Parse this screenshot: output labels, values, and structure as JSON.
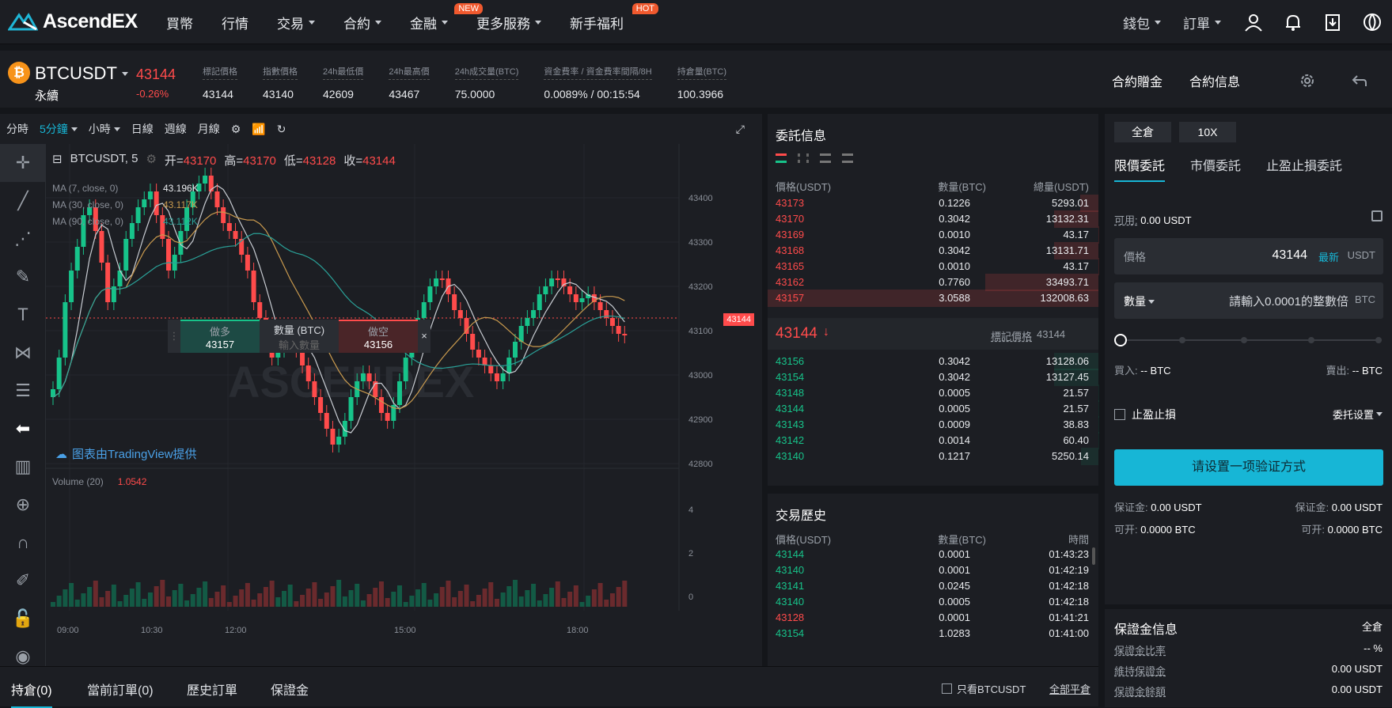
{
  "header": {
    "logo_text": "AscendEX",
    "nav": [
      {
        "label": "買幣",
        "caret": false,
        "badge": ""
      },
      {
        "label": "行情",
        "caret": false,
        "badge": ""
      },
      {
        "label": "交易",
        "caret": true,
        "badge": ""
      },
      {
        "label": "合約",
        "caret": true,
        "badge": ""
      },
      {
        "label": "金融",
        "caret": true,
        "badge": "NEW"
      },
      {
        "label": "更多服務",
        "caret": true,
        "badge": ""
      },
      {
        "label": "新手福利",
        "caret": false,
        "badge": "HOT"
      }
    ],
    "wallet_label": "錢包",
    "orders_label": "訂單"
  },
  "ticker": {
    "coin_icon": "₿",
    "symbol": "BTCUSDT",
    "type": "永續",
    "last_price": "43144",
    "change": "-0.26%",
    "stats": [
      {
        "label": "標記價格",
        "value": "43144"
      },
      {
        "label": "指數價格",
        "value": "43140"
      },
      {
        "label": "24h最低價",
        "value": "42609"
      },
      {
        "label": "24h最高價",
        "value": "43467"
      },
      {
        "label": "24h成交量(BTC)",
        "value": "75.0000"
      },
      {
        "label": "資金費率 / 資金費率間隔/8H",
        "value": "0.0089% / 00:15:54"
      },
      {
        "label": "持倉量(BTC)",
        "value": "100.3966"
      }
    ],
    "bonus_label": "合約贈金",
    "info_label": "合約信息"
  },
  "chart_toolbar": [
    "分時",
    "5分鐘",
    "小時",
    "日線",
    "週線",
    "月線"
  ],
  "chart": {
    "legend_symbol": "BTCUSDT, 5",
    "ohlc": {
      "o_label": "开=",
      "o": "43170",
      "h_label": "高=",
      "h": "43170",
      "l_label": "低=",
      "l": "43128",
      "c_label": "收=",
      "c": "43144"
    },
    "ma": [
      {
        "label": "MA (7, close, 0)",
        "value": "43.196K",
        "color": "#e9ebee"
      },
      {
        "label": "MA (30, close, 0)",
        "value": "43.117K",
        "color": "#c99a4e"
      },
      {
        "label": "MA (90, close, 0)",
        "value": "43.112K",
        "color": "#2aa198"
      }
    ],
    "price_ticks": [
      "43400",
      "43300",
      "43200",
      "43100",
      "43000",
      "42900",
      "42800"
    ],
    "price_tag": "43144",
    "time_ticks": [
      "09:00",
      "10:30",
      "12:00",
      "15:00",
      "18:00"
    ],
    "volume_label": "Volume (20)",
    "volume_value": "1.0542",
    "volume_ticks": [
      "4",
      "2",
      "0"
    ],
    "tv_credit": "图表由TradingView提供",
    "quick": {
      "long_label": "做多",
      "long_price": "43157",
      "qty_label": "數量 (BTC)",
      "qty_placeholder": "輸入數量",
      "short_label": "做空",
      "short_price": "43156"
    }
  },
  "orderbook": {
    "title": "委託信息",
    "headers": [
      "價格(USDT)",
      "數量(BTC)",
      "總量(USDT)"
    ],
    "asks": [
      {
        "price": "43173",
        "qty": "0.1226",
        "total": "5293.01"
      },
      {
        "price": "43170",
        "qty": "0.3042",
        "total": "13132.31"
      },
      {
        "price": "43169",
        "qty": "0.0010",
        "total": "43.17"
      },
      {
        "price": "43168",
        "qty": "0.3042",
        "total": "13131.71"
      },
      {
        "price": "43165",
        "qty": "0.0010",
        "total": "43.17"
      },
      {
        "price": "43162",
        "qty": "0.7760",
        "total": "33493.71"
      },
      {
        "price": "43157",
        "qty": "3.0588",
        "total": "132008.63"
      }
    ],
    "mid_price": "43144",
    "mark_label": "標記價格",
    "mark_price": "43144",
    "bids": [
      {
        "price": "43156",
        "qty": "0.3042",
        "total": "13128.06"
      },
      {
        "price": "43154",
        "qty": "0.3042",
        "total": "13127.45"
      },
      {
        "price": "43148",
        "qty": "0.0005",
        "total": "21.57"
      },
      {
        "price": "43144",
        "qty": "0.0005",
        "total": "21.57"
      },
      {
        "price": "43143",
        "qty": "0.0009",
        "total": "38.83"
      },
      {
        "price": "43142",
        "qty": "0.0014",
        "total": "60.40"
      },
      {
        "price": "43140",
        "qty": "0.1217",
        "total": "5250.14"
      }
    ]
  },
  "trades": {
    "title": "交易歷史",
    "headers": [
      "價格(USDT)",
      "數量(BTC)",
      "時間"
    ],
    "rows": [
      {
        "price": "43144",
        "qty": "0.0001",
        "time": "01:43:23",
        "side": "buy"
      },
      {
        "price": "43140",
        "qty": "0.0001",
        "time": "01:42:19",
        "side": "buy"
      },
      {
        "price": "43141",
        "qty": "0.0245",
        "time": "01:42:18",
        "side": "buy"
      },
      {
        "price": "43140",
        "qty": "0.0005",
        "time": "01:42:18",
        "side": "buy"
      },
      {
        "price": "43128",
        "qty": "0.0001",
        "time": "01:41:21",
        "side": "sell"
      },
      {
        "price": "43154",
        "qty": "1.0283",
        "time": "01:41:00",
        "side": "buy"
      }
    ]
  },
  "trade_panel": {
    "margin_mode": "全倉",
    "leverage": "10X",
    "tabs": [
      "限價委託",
      "市價委託",
      "止盈止損委託"
    ],
    "available_label": "可用:",
    "available_value": "0.00 USDT",
    "price_label": "價格",
    "price_value": "43144",
    "latest_label": "最新",
    "price_unit": "USDT",
    "qty_label": "數量",
    "qty_placeholder": "請輸入0.0001的整數倍",
    "qty_unit": "BTC",
    "buy_label": "買入:",
    "buy_value": "-- BTC",
    "sell_label": "賣出:",
    "sell_value": "-- BTC",
    "tpsl_label": "止盈止損",
    "order_settings": "委托设置",
    "cta": "请设置一项验证方式",
    "margin_l_label": "保证金:",
    "margin_l": "0.00 USDT",
    "margin_r_label": "保证金:",
    "margin_r": "0.00 USDT",
    "open_l_label": "可开:",
    "open_l": "0.0000 BTC",
    "open_r_label": "可开:",
    "open_r": "0.0000 BTC",
    "margin_info_title": "保證金信息",
    "margin_info_mode": "全倉",
    "margin_rows": [
      {
        "label": "保證金比率",
        "value": "-- %"
      },
      {
        "label": "維持保證金",
        "value": "0.00 USDT"
      },
      {
        "label": "保證金餘額",
        "value": "0.00 USDT"
      }
    ]
  },
  "bottom_tabs": [
    "持倉(0)",
    "當前訂單(0)",
    "歷史訂單",
    "保證金"
  ],
  "bottom_right": {
    "only_label": "只看BTCUSDT",
    "close_all": "全部平倉"
  },
  "colors": {
    "up": "#17c38a",
    "down": "#ff4b4b",
    "accent": "#17b6d6",
    "bg": "#1c1e23"
  }
}
